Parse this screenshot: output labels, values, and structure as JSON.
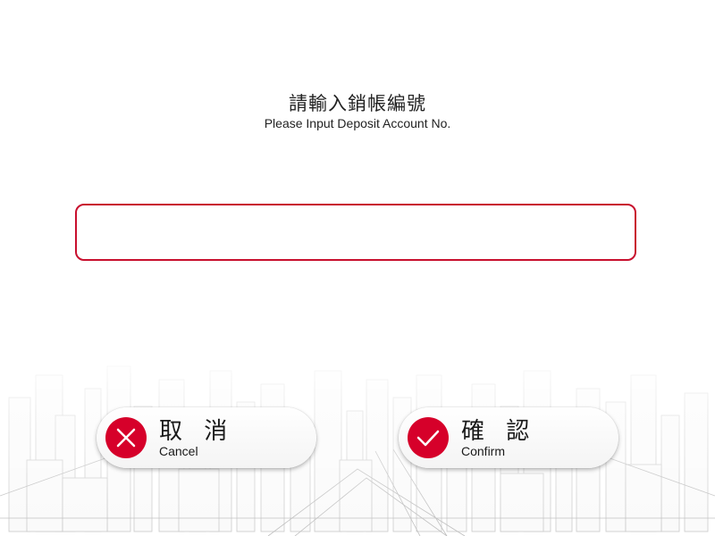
{
  "prompt": {
    "title_zh": "請輸入銷帳編號",
    "title_en": "Please Input Deposit Account No."
  },
  "account_input": {
    "value": "",
    "placeholder": ""
  },
  "cancel_button": {
    "label_zh": "取 消",
    "label_en": "Cancel",
    "icon": "close-icon"
  },
  "confirm_button": {
    "label_zh": "確 認",
    "label_en": "Confirm",
    "icon": "check-icon"
  },
  "colors": {
    "accent": "#d6002a",
    "input_border": "#c8102e",
    "text": "#222222"
  }
}
